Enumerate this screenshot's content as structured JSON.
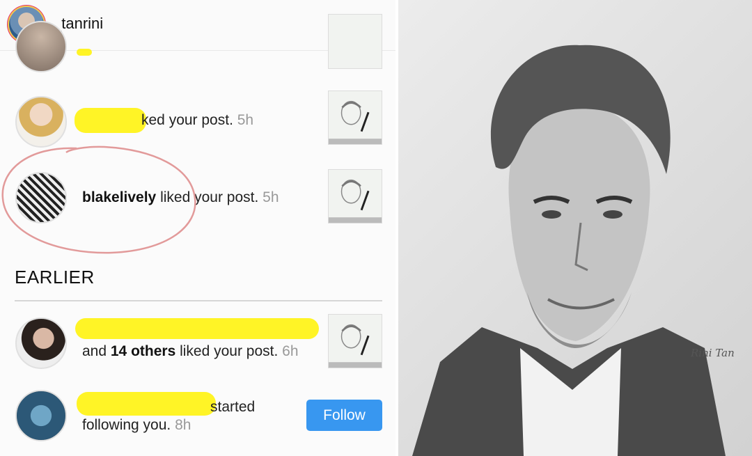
{
  "header": {
    "username": "_tanrini"
  },
  "notifications": [
    {
      "user": "",
      "action_fragment": "ked your post.",
      "time": "5h",
      "user_redacted": true
    },
    {
      "user": "blakelively",
      "action": " liked your post.",
      "time": "5h"
    }
  ],
  "earlier": {
    "title": "EARLIER",
    "items": [
      {
        "prefix": "and ",
        "count_text": "14 others",
        "action": " liked your post.",
        "time": "6h"
      },
      {
        "action_line1": "started",
        "action_line2": "following you.",
        "time": "8h",
        "button": "Follow"
      }
    ]
  },
  "drawing": {
    "signature": "Rini Tan"
  },
  "colors": {
    "follow_button": "#3897f0",
    "highlight": "#fff200",
    "circle_annotation": "#e29a9a"
  }
}
